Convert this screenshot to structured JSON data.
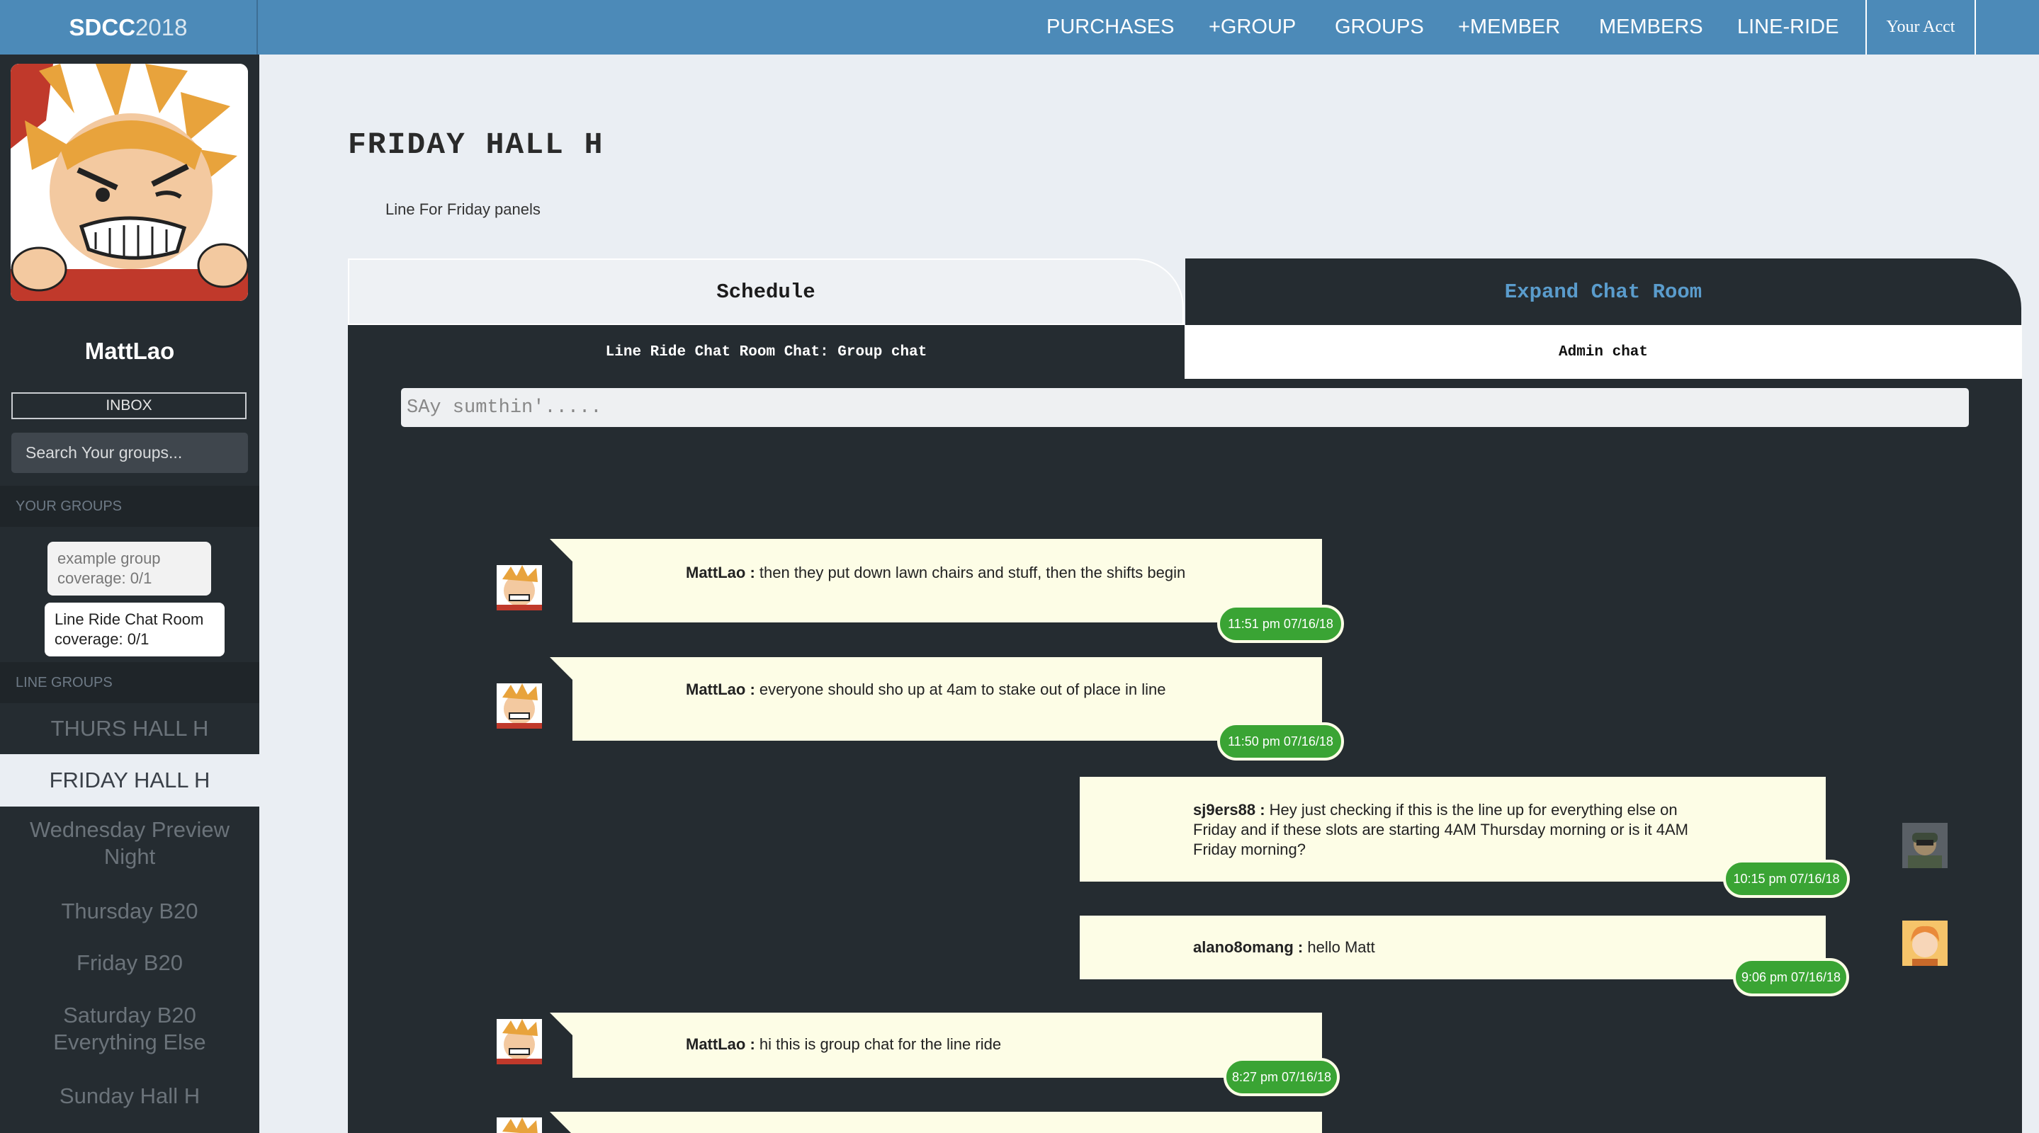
{
  "nav": {
    "brand_bold": "SDCC",
    "brand_light": "2018",
    "links": [
      "PURCHASES",
      "+GROUP",
      "GROUPS",
      "+MEMBER",
      "MEMBERS",
      "LINE-RIDE"
    ],
    "account": "Your Acct"
  },
  "sidebar": {
    "username": "MattLao",
    "inbox": "INBOX",
    "search_placeholder": "Search Your groups...",
    "your_groups_header": "YOUR GROUPS",
    "your_groups": [
      {
        "name": "example group",
        "coverage": "coverage: 0/1"
      },
      {
        "name": "Line Ride Chat Room",
        "coverage": "coverage: 0/1"
      }
    ],
    "line_groups_header": "LINE GROUPS",
    "line_groups": [
      "THURS HALL H",
      "FRIDAY HALL H",
      "Wednesday Preview Night",
      "Thursday B20",
      "Friday B20",
      "Saturday B20 Everything Else",
      "Sunday Hall H"
    ]
  },
  "main": {
    "title": "FRIDAY HALL H",
    "description": "Line For Friday panels",
    "tab_schedule": "Schedule",
    "tab_chat": "Expand Chat Room",
    "subtab_group": "Line Ride Chat Room Chat: Group chat",
    "subtab_admin": "Admin chat",
    "chat_placeholder": "SAy sumthin'....."
  },
  "messages": [
    {
      "user": "MattLao :",
      "text": "then they put down lawn chairs and stuff, then the shifts begin",
      "time": "11:51 pm 07/16/18"
    },
    {
      "user": "MattLao :",
      "text": "everyone should sho up at 4am to stake out of place in line",
      "time": "11:50 pm 07/16/18"
    },
    {
      "user": "sj9ers88 :",
      "text": "Hey just checking if this is the line up for everything else on Friday and if these slots are starting 4AM Thursday morning or is it 4AM Friday morning?",
      "time": "10:15 pm 07/16/18"
    },
    {
      "user": "alano8omang :",
      "text": "hello Matt",
      "time": "9:06 pm 07/16/18"
    },
    {
      "user": "MattLao :",
      "text": "hi this is group chat for the line ride",
      "time": "8:27 pm 07/16/18"
    }
  ]
}
